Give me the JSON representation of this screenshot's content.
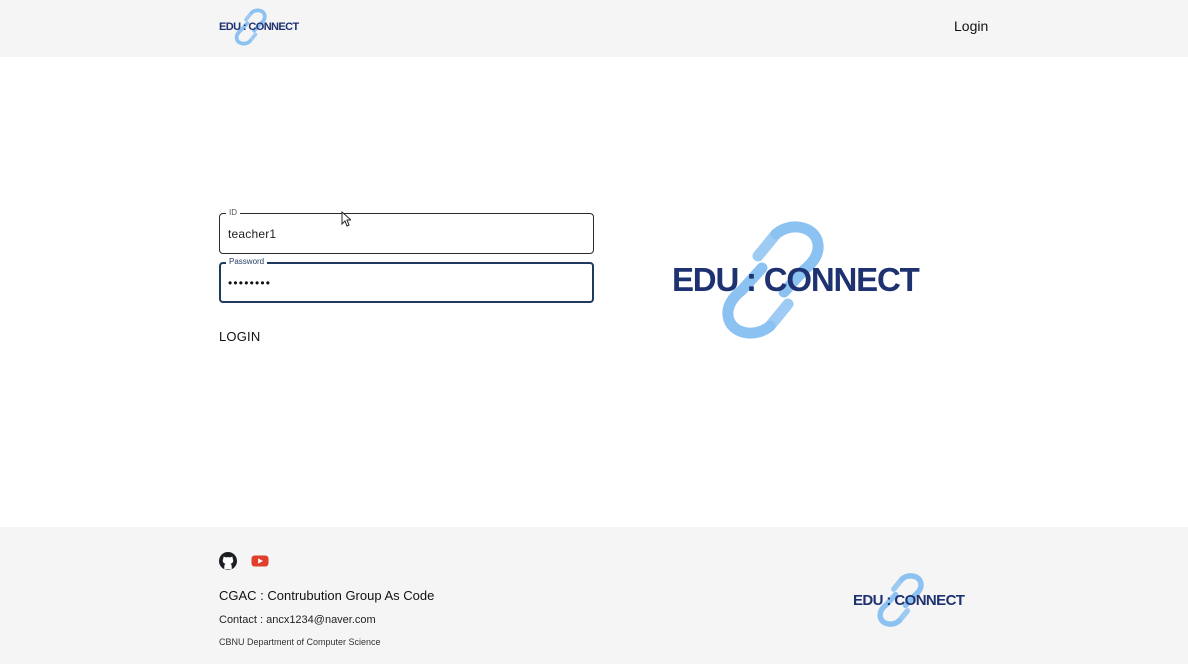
{
  "header": {
    "logo": {
      "text": "EDU : CONNECT",
      "icon": "chain-link-icon"
    },
    "nav_login": "Login"
  },
  "login_form": {
    "id_field": {
      "label": "ID",
      "value": "teacher1"
    },
    "password_field": {
      "label": "Password",
      "masked_value": "••••••••"
    },
    "submit_label": "LOGIN"
  },
  "hero": {
    "logo": {
      "text": "EDU : CONNECT",
      "icon": "chain-link-icon"
    }
  },
  "footer": {
    "social": [
      {
        "name": "github-icon",
        "color": "#1b1f23"
      },
      {
        "name": "youtube-icon",
        "color": "#e0402b"
      }
    ],
    "title": "CGAC : Contrubution Group As Code",
    "contact": "Contact : ancx1234@naver.com",
    "department": "CBNU Department of Computer Science",
    "logo": {
      "text": "EDU : CONNECT",
      "icon": "chain-link-icon"
    }
  },
  "colors": {
    "brand_navy": "#1e3170",
    "link_blue": "#8cc2f2",
    "focus_border": "#1f3a5f",
    "bar_background": "#f5f5f5"
  }
}
